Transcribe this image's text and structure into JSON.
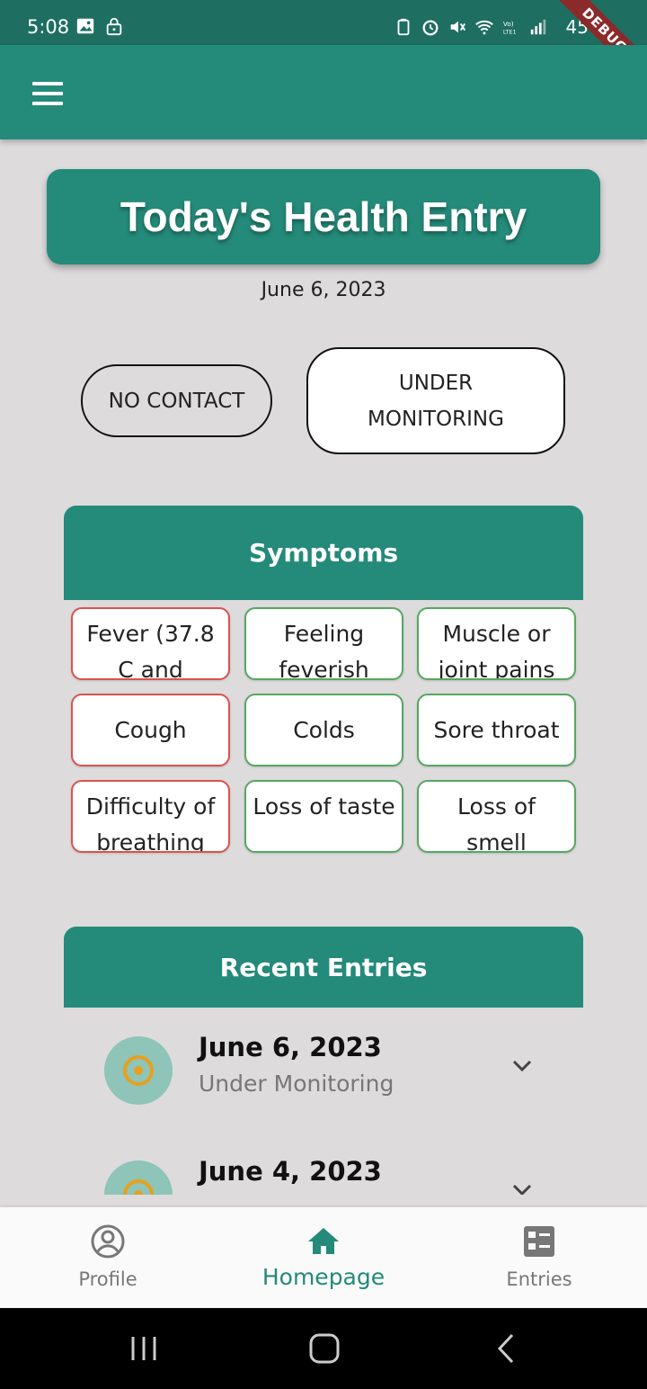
{
  "status_bar": {
    "time": "5:08",
    "battery": "45%",
    "debug_ribbon": "DEBUG"
  },
  "header": {
    "title": "Today's Health Entry",
    "date": "June 6, 2023"
  },
  "status_options": {
    "no_contact": "NO CONTACT",
    "under_monitoring": "UNDER MONITORING"
  },
  "symptoms": {
    "title": "Symptoms",
    "items": [
      {
        "label": "Fever (37.8 C and",
        "severity": "red"
      },
      {
        "label": "Feeling feverish",
        "severity": "green"
      },
      {
        "label": "Muscle or joint pains",
        "severity": "green"
      },
      {
        "label": "Cough",
        "severity": "red"
      },
      {
        "label": "Colds",
        "severity": "green"
      },
      {
        "label": "Sore throat",
        "severity": "green"
      },
      {
        "label": "Difficulty of breathing",
        "severity": "red"
      },
      {
        "label": "Loss of taste",
        "severity": "green"
      },
      {
        "label": "Loss of smell",
        "severity": "green"
      }
    ]
  },
  "recent_entries": {
    "title": "Recent Entries",
    "items": [
      {
        "date": "June 6, 2023",
        "status": "Under Monitoring"
      },
      {
        "date": "June 4, 2023",
        "status": ""
      }
    ]
  },
  "bottom_nav": {
    "profile": "Profile",
    "homepage": "Homepage",
    "entries": "Entries"
  },
  "colors": {
    "primary": "#248a79",
    "status_bar": "#1e6e62",
    "severe_border": "#d9534f",
    "mild_border": "#55a860",
    "entry_icon": "#e6a020"
  }
}
